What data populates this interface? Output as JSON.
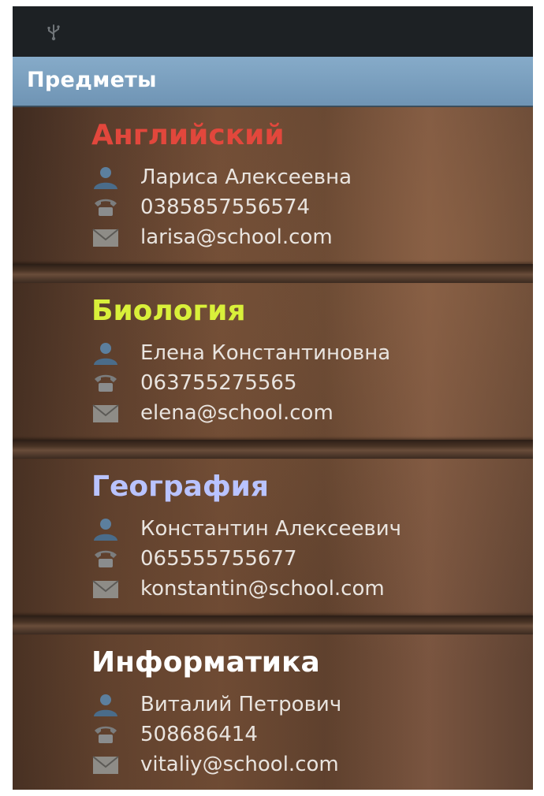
{
  "app": {
    "title": "Предметы"
  },
  "status_bar": {
    "icons": [
      "usb-icon"
    ]
  },
  "colors": {
    "title_bar": "#7b9fbe",
    "subject_english": "#e2473c",
    "subject_biology": "#d9f03a",
    "subject_geography": "#b9c3ff",
    "subject_informatics": "#ffffff"
  },
  "subjects": [
    {
      "name": "Английский",
      "teacher": "Лариса Алексеевна",
      "phone": "0385857556574",
      "email": "larisa@school.com"
    },
    {
      "name": "Биология",
      "teacher": "Елена Константиновна",
      "phone": "063755275565",
      "email": "elena@school.com"
    },
    {
      "name": "География",
      "teacher": "Константин Алексеевич",
      "phone": "065555755677",
      "email": "konstantin@school.com"
    },
    {
      "name": "Информатика",
      "teacher": "Виталий Петрович",
      "phone": "508686414",
      "email": "vitaliy@school.com"
    }
  ],
  "icons": {
    "teacher": "person-icon",
    "phone": "phone-icon",
    "email": "envelope-icon"
  }
}
